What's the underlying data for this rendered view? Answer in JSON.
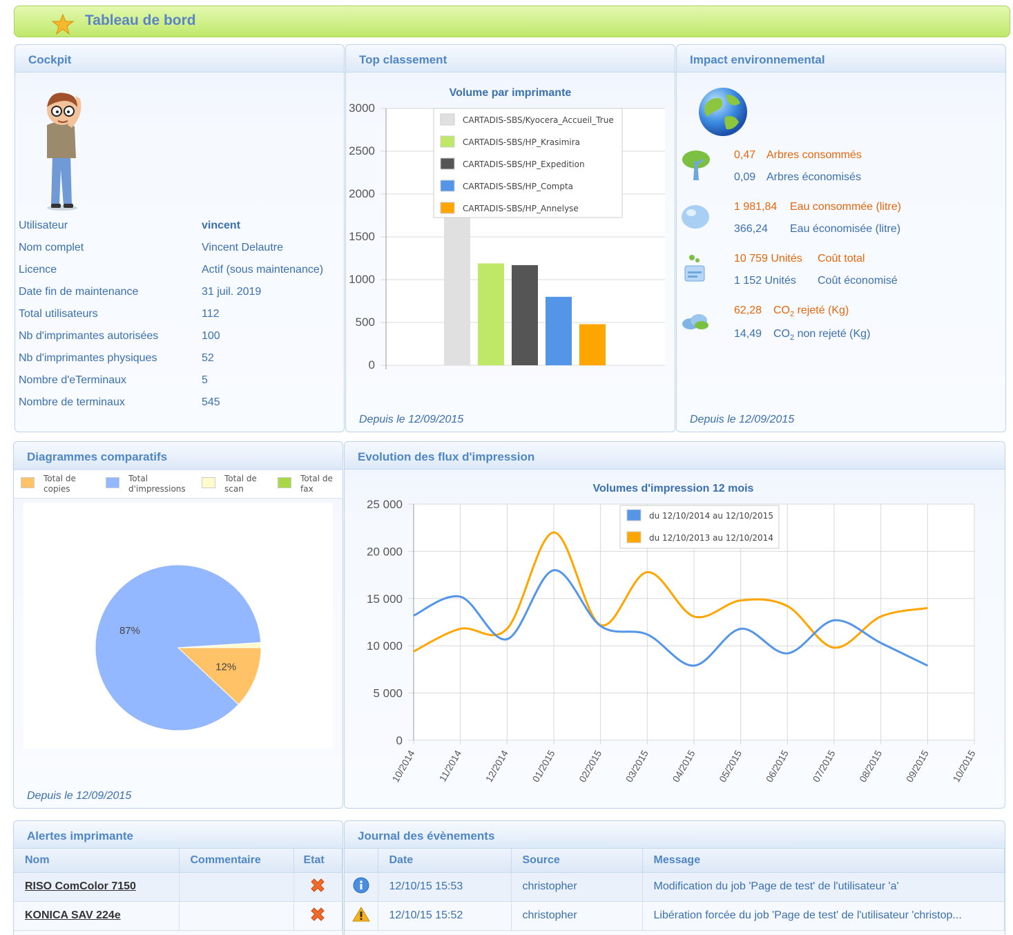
{
  "header": {
    "title": "Tableau de bord"
  },
  "cockpit": {
    "title": "Cockpit",
    "rows": [
      {
        "label": "Utilisateur",
        "value": "vincent"
      },
      {
        "label": "Nom complet",
        "value": "Vincent Delautre"
      },
      {
        "label": "Licence",
        "value": "Actif (sous maintenance)"
      },
      {
        "label": "Date fin de maintenance",
        "value": "31 juil. 2019"
      },
      {
        "label": "Total utilisateurs",
        "value": "112"
      },
      {
        "label": "Nb d'imprimantes autorisées",
        "value": "100"
      },
      {
        "label": "Nb d'imprimantes physiques",
        "value": "52"
      },
      {
        "label": "Nombre d'eTerminaux",
        "value": "5"
      },
      {
        "label": "Nombre de terminaux",
        "value": "545"
      }
    ]
  },
  "top": {
    "title": "Top classement",
    "since": "Depuis le 12/09/2015"
  },
  "env": {
    "title": "Impact environnemental",
    "since": "Depuis le 12/09/2015",
    "trees_used": {
      "value": "0,47",
      "label": "Arbres consommés"
    },
    "trees_saved": {
      "value": "0,09",
      "label": "Arbres économisés"
    },
    "water_used": {
      "value": "1 981,84",
      "label": "Eau consommée (litre)"
    },
    "water_saved": {
      "value": "366,24",
      "label": "Eau économisée (litre)"
    },
    "cost_total": {
      "value": "10 759 Unités",
      "label": "Coût total"
    },
    "cost_saved": {
      "value": "1 152 Unités",
      "label": "Coût économisé"
    },
    "co2_rejected": {
      "value": "62,28",
      "label_pre": "CO",
      "label_sub": "2",
      "label_post": " rejeté (Kg)"
    },
    "co2_not_rejected": {
      "value": "14,49",
      "label_pre": "CO",
      "label_sub": "2",
      "label_post": " non rejeté (Kg)"
    }
  },
  "diag": {
    "title": "Diagrammes comparatifs",
    "since": "Depuis le 12/09/2015",
    "legend": [
      {
        "line1": "Total de",
        "line2": "copies",
        "color": "#ffc266"
      },
      {
        "line1": "Total",
        "line2": "d'impressions",
        "color": "#94b8ff"
      },
      {
        "line1": "Total de",
        "line2": "scan",
        "color": "#fffbcc"
      },
      {
        "line1": "Total de",
        "line2": "fax",
        "color": "#a8d848"
      }
    ]
  },
  "evol": {
    "title": "Evolution des flux d'impression"
  },
  "alerts": {
    "title": "Alertes imprimante",
    "columns": [
      "Nom",
      "Commentaire",
      "Etat"
    ],
    "rows": [
      {
        "name": "RISO ComColor 7150",
        "comment": "",
        "state_icon": "error-cross-icon"
      },
      {
        "name": "KONICA SAV 224e",
        "comment": "",
        "state_icon": "error-cross-icon"
      }
    ]
  },
  "journal": {
    "title": "Journal des évènements",
    "columns": [
      "",
      "Date",
      "Source",
      "Message"
    ],
    "rows": [
      {
        "icon": "info-icon",
        "date": "12/10/15 15:53",
        "source": "christopher",
        "message": "Modification du job 'Page de test' de l'utilisateur 'a'"
      },
      {
        "icon": "warning-icon",
        "date": "12/10/15 15:52",
        "source": "christopher",
        "message": "Libération forcée du job 'Page de test' de l'utilisateur 'christop..."
      }
    ]
  },
  "chart_data": [
    {
      "type": "bar",
      "title": "Volume par imprimante",
      "ylim": [
        0,
        3000
      ],
      "yticks": [
        "0",
        "500",
        "1000",
        "1500",
        "2000",
        "2500",
        "3000"
      ],
      "series": [
        {
          "name": "CARTADIS-SBS/Kyocera_Accueil_True",
          "value": 2600,
          "color": "#e0e0e0"
        },
        {
          "name": "CARTADIS-SBS/HP_Krasimira",
          "value": 1190,
          "color": "#c0e868"
        },
        {
          "name": "CARTADIS-SBS/HP_Expedition",
          "value": 1170,
          "color": "#555555"
        },
        {
          "name": "CARTADIS-SBS/HP_Compta",
          "value": 800,
          "color": "#5595e8"
        },
        {
          "name": "CARTADIS-SBS/HP_Annelyse",
          "value": 480,
          "color": "#ffa500"
        }
      ]
    },
    {
      "type": "pie",
      "slices": [
        {
          "name": "Total d'impressions",
          "value": 87,
          "label": "87%",
          "color": "#94b8ff"
        },
        {
          "name": "Total de copies",
          "value": 12,
          "label": "12%",
          "color": "#ffc266"
        },
        {
          "name": "Total de scan",
          "value": 1,
          "label": "",
          "color": "#fffbcc"
        }
      ]
    },
    {
      "type": "line",
      "title": "Volumes d'impression 12 mois",
      "ylim": [
        0,
        25000
      ],
      "yticks": [
        "0",
        "5 000",
        "10 000",
        "15 000",
        "20 000",
        "25 000"
      ],
      "x": [
        "10/2014",
        "11/2014",
        "12/2014",
        "01/2015",
        "02/2015",
        "03/2015",
        "04/2015",
        "05/2015",
        "06/2015",
        "07/2015",
        "08/2015",
        "09/2015",
        "10/2015"
      ],
      "series": [
        {
          "name": "du 12/10/2014 au 12/10/2015",
          "color": "#5595e8",
          "values": [
            13200,
            15200,
            10700,
            18000,
            12100,
            11200,
            7900,
            11800,
            9200,
            12700,
            10300,
            7900
          ]
        },
        {
          "name": "du 12/10/2013 au 12/10/2014",
          "color": "#ffa500",
          "values": [
            9400,
            11800,
            11800,
            22000,
            12200,
            17800,
            13100,
            14800,
            14200,
            9800,
            13100,
            14000
          ]
        }
      ]
    }
  ]
}
